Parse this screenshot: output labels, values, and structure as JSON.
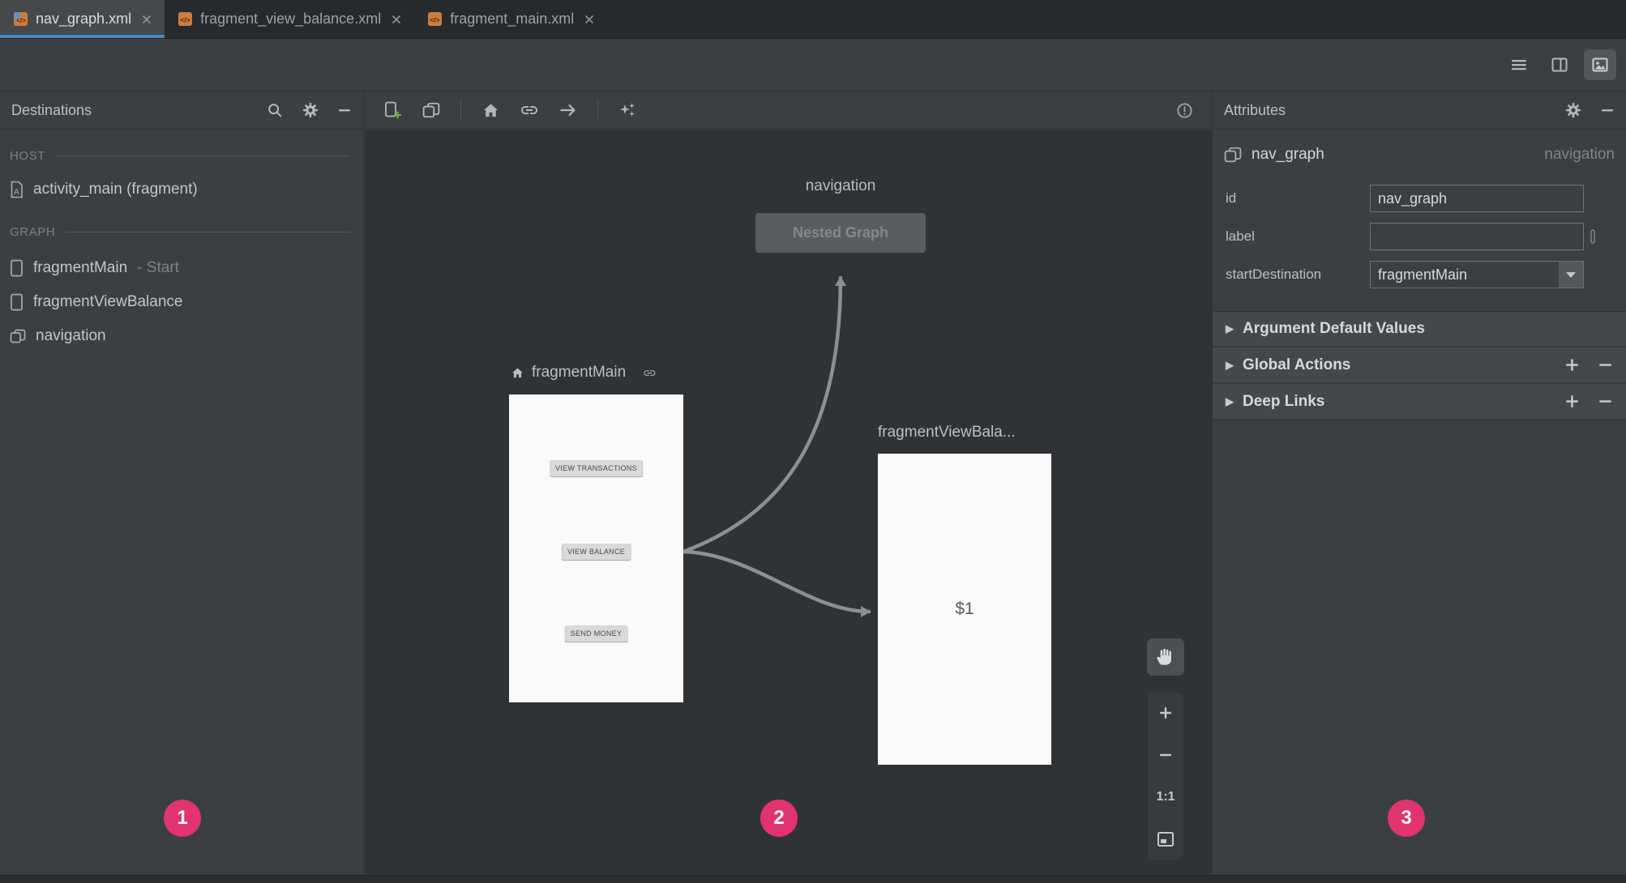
{
  "tabs": [
    {
      "label": "nav_graph.xml",
      "active": true
    },
    {
      "label": "fragment_view_balance.xml",
      "active": false
    },
    {
      "label": "fragment_main.xml",
      "active": false
    }
  ],
  "destinations": {
    "title": "Destinations",
    "host_label": "HOST",
    "host_items": [
      {
        "label": "activity_main (fragment)"
      }
    ],
    "graph_label": "GRAPH",
    "graph_items": [
      {
        "label": "fragmentMain",
        "suffix": "- Start"
      },
      {
        "label": "fragmentViewBalance",
        "suffix": ""
      },
      {
        "label": "navigation",
        "suffix": ""
      }
    ]
  },
  "canvas": {
    "nested_graph": {
      "title": "navigation",
      "button_label": "Nested Graph"
    },
    "fragment_main": {
      "title": "fragmentMain",
      "preview_buttons": [
        "VIEW TRANSACTIONS",
        "VIEW BALANCE",
        "SEND MONEY"
      ]
    },
    "fragment_view_balance": {
      "title": "fragmentViewBala...",
      "preview_text": "$1"
    },
    "zoom_label": "1:1"
  },
  "attributes": {
    "title": "Attributes",
    "component": {
      "name": "nav_graph",
      "type": "navigation"
    },
    "fields": [
      {
        "label": "id",
        "value": "nav_graph"
      },
      {
        "label": "label",
        "value": ""
      },
      {
        "label": "startDestination",
        "value": "fragmentMain"
      }
    ],
    "sections": [
      {
        "label": "Argument Default Values",
        "has_add_remove": false
      },
      {
        "label": "Global Actions",
        "has_add_remove": true
      },
      {
        "label": "Deep Links",
        "has_add_remove": true
      }
    ]
  },
  "badges": [
    "1",
    "2",
    "3"
  ],
  "colors": {
    "accent_blue": "#4a88c7",
    "badge_pink": "#e1336f",
    "panel_bg": "#3c3f41",
    "canvas_bg": "#303335",
    "preview_bg": "#fafafa",
    "arrow_gray": "#8d9092",
    "add_green": "#62b543",
    "file_icon_orange": "#cd7d3f"
  }
}
